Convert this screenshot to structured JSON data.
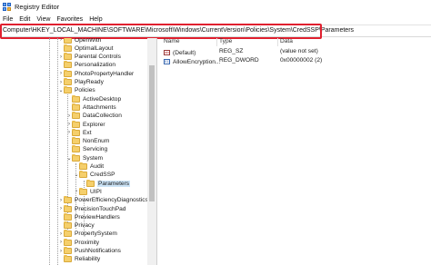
{
  "window": {
    "title": "Registry Editor"
  },
  "menu": [
    "File",
    "Edit",
    "View",
    "Favorites",
    "Help"
  ],
  "address": {
    "path": "Computer\\HKEY_LOCAL_MACHINE\\SOFTWARE\\Microsoft\\Windows\\CurrentVersion\\Policies\\System\\CredSSP\\Parameters"
  },
  "tree": {
    "items": [
      {
        "label": "OpenWith",
        "expander": "›"
      },
      {
        "label": "OptimalLayout",
        "expander": ""
      },
      {
        "label": "Parental Controls",
        "expander": "›"
      },
      {
        "label": "Personalization",
        "expander": ""
      },
      {
        "label": "PhotoPropertyHandler",
        "expander": "›"
      },
      {
        "label": "PlayReady",
        "expander": "›"
      },
      {
        "label": "Policies",
        "expander": "⌄"
      },
      {
        "label": "ActiveDesktop",
        "expander": ""
      },
      {
        "label": "Attachments",
        "expander": ""
      },
      {
        "label": "DataCollection",
        "expander": "›"
      },
      {
        "label": "Explorer",
        "expander": "›"
      },
      {
        "label": "Ext",
        "expander": "›"
      },
      {
        "label": "NonEnum",
        "expander": ""
      },
      {
        "label": "Servicing",
        "expander": ""
      },
      {
        "label": "System",
        "expander": "⌄"
      },
      {
        "label": "Audit",
        "expander": ""
      },
      {
        "label": "CredSSP",
        "expander": "⌄"
      },
      {
        "label": "Parameters",
        "expander": ""
      },
      {
        "label": "UIPI",
        "expander": "›"
      },
      {
        "label": "PowerEfficiencyDiagnostics",
        "expander": "›"
      },
      {
        "label": "PrecisionTouchPad",
        "expander": "›"
      },
      {
        "label": "PreviewHandlers",
        "expander": ""
      },
      {
        "label": "Privacy",
        "expander": ""
      },
      {
        "label": "PropertySystem",
        "expander": "›"
      },
      {
        "label": "Proximity",
        "expander": "›"
      },
      {
        "label": "PushNotifications",
        "expander": "›"
      },
      {
        "label": "Reliability",
        "expander": ""
      }
    ]
  },
  "values": {
    "headers": [
      "Name",
      "Type",
      "Data"
    ],
    "rows": [
      {
        "icon": "string-value-icon",
        "icon_text": "ab",
        "name": "(Default)",
        "type": "REG_SZ",
        "data": "(value not set)"
      },
      {
        "icon": "binary-value-icon",
        "icon_text": "011",
        "name": "AllowEncryption...",
        "type": "REG_DWORD",
        "data": "0x00000002 (2)"
      }
    ]
  },
  "colors": {
    "highlight": "#e0202f",
    "folder": "#f5cf6b",
    "selection": "#cce4f7"
  }
}
